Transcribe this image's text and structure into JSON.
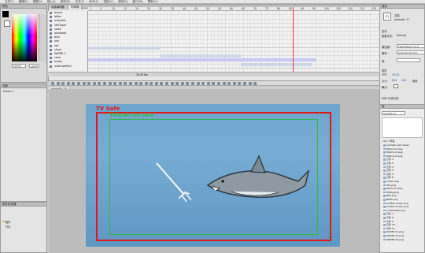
{
  "menubar": {
    "items": [
      "文件(F)",
      "编辑(E)",
      "视图(V)",
      "插入(I)",
      "修改(M)",
      "文本(T)",
      "命令(C)",
      "控制(O)",
      "调试(D)",
      "窗口(W)",
      "帮助(H)"
    ]
  },
  "timeline": {
    "tabs": [
      "动画编辑器",
      "时间轴"
    ],
    "ruler": [
      "1",
      "5",
      "10",
      "15",
      "20",
      "25",
      "30",
      "35",
      "40",
      "45",
      "50",
      "55",
      "60",
      "65",
      "70",
      "75",
      "80",
      "85",
      "90",
      "95",
      "100",
      "105",
      "110",
      "115",
      "120",
      "125",
      "130",
      "135",
      "140"
    ],
    "layers": [
      "frame",
      "letter",
      "outsidein",
      "life/Triple",
      "scale",
      "outsideat",
      "bins",
      "one",
      "edt",
      "shark",
      "WATER 1",
      "cave",
      "ocean",
      "underwaffect"
    ],
    "footer": "30.00 fps"
  },
  "colors": {
    "stroke": "#000000",
    "fill": "#ffffff",
    "hex": "FFFFFF",
    "alpha": "100%",
    "label": "颜色"
  },
  "left_panels": {
    "scene": "Scene 1",
    "components": "组件",
    "behaviors": "行为",
    "component_inspector": "组件检查器"
  },
  "document": {
    "tab": "animatic 1*",
    "scene": "Scene 1",
    "zoom_label": "符合窗口大小",
    "tv_safe": "TV Safe",
    "title_safe": "Title/Action Safe"
  },
  "properties": {
    "title": "属性",
    "doc_label": "文档",
    "doc_name": "animatic 1*",
    "publish": "发布",
    "profile_label": "配置文件:",
    "profile": "Default",
    "target_label": "播放器:",
    "target": "Flash Player 11.2",
    "script_label": "脚本:",
    "script": "ActionScript 3.0",
    "class_label": "类:",
    "props": "属性",
    "fps_label": "FPS:",
    "fps": "30.00",
    "size_label": "大小:",
    "width": "800",
    "height": "450",
    "unit": "像素",
    "stage_label": "舞台:",
    "swf_history": "SWF 历史记录"
  },
  "library": {
    "title": "库",
    "doc": "animatic 1",
    "count": "120 个项目",
    "items": [
      "animatic.psd Asset",
      "fishmonk.png",
      "fishmonk.png",
      "fishmonk.png",
      "元件 1",
      "元件 2",
      "元件 3",
      "元件 4",
      "元件 5",
      "元件 6",
      "ocean.png",
      "fish.png",
      "fishmonk.png",
      "fishbg.png",
      "NES.png",
      "NESh.png",
      "bubble screen.png",
      "bubble screen.png",
      "underwater.png",
      "元件 7",
      "元件 8",
      "元件 9",
      "元件 10",
      "元件 11",
      "WATER 01.png",
      "WATER 02.png",
      "WATER 03.png"
    ]
  },
  "accent": {
    "tv": "#e01818",
    "title": "#2dbb3a",
    "playhead": "#e8383d"
  }
}
